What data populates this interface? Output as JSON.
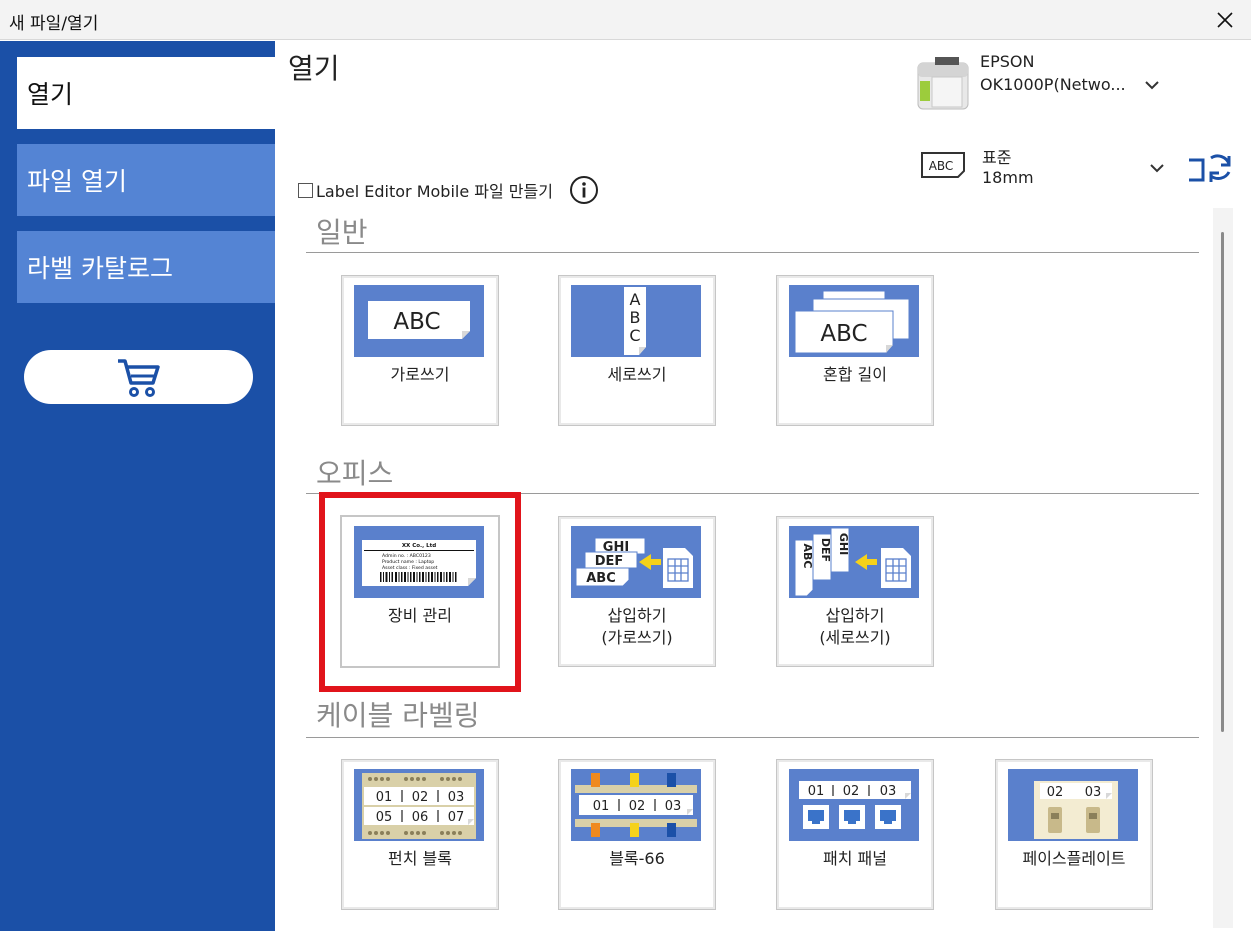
{
  "window": {
    "title": "새 파일/열기",
    "close_icon": "close-icon"
  },
  "sidebar": {
    "items": [
      {
        "label": "열기",
        "active": true
      },
      {
        "label": "파일 열기",
        "active": false
      },
      {
        "label": "라벨 카탈로그",
        "active": false
      }
    ],
    "cart_icon": "cart-icon"
  },
  "main": {
    "title": "열기",
    "printer": {
      "brand": "EPSON",
      "model": "OK1000P(Netwo..."
    },
    "tape": {
      "type": "표준",
      "width": "18mm",
      "icon_text": "ABC"
    },
    "label_editor_mobile": {
      "label": "Label Editor Mobile 파일 만들기",
      "checked": false
    }
  },
  "sections": [
    {
      "title": "일반",
      "tiles": [
        {
          "label": "가로쓰기",
          "thumb_text": "ABC"
        },
        {
          "label": "세로쓰기",
          "thumb_text": [
            "A",
            "B",
            "C"
          ]
        },
        {
          "label": "혼합 길이",
          "thumb_text": "ABC"
        }
      ]
    },
    {
      "title": "오피스",
      "tiles": [
        {
          "label": "장비 관리",
          "selected": true,
          "thumb_text": {
            "company": "XX Co., Ltd",
            "rows": [
              "Admin no.      : ABC0123",
              "Product name : Laptop",
              "Asset class    : Fixed asset"
            ]
          }
        },
        {
          "label": "삽입하기\n(가로쓰기)",
          "thumb_text": [
            "GHI",
            "DEF",
            "ABC"
          ]
        },
        {
          "label": "삽입하기\n(세로쓰기)",
          "thumb_text": [
            "ABC",
            "DEF",
            "GHI"
          ]
        }
      ]
    },
    {
      "title": "케이블 라벨링",
      "tiles": [
        {
          "label": "펀치 블록",
          "thumb_text": [
            "01",
            "02",
            "03",
            "05",
            "06",
            "07"
          ]
        },
        {
          "label": "블록-66",
          "thumb_text": [
            "01",
            "02",
            "03"
          ]
        },
        {
          "label": "패치 패널",
          "thumb_text": [
            "01",
            "02",
            "03"
          ]
        },
        {
          "label": "페이스플레이트",
          "thumb_text": [
            "02",
            "03"
          ]
        }
      ]
    }
  ],
  "colors": {
    "sidebar": "#1b50a7",
    "nav_item": "#5484d4",
    "thumb": "#5a80cc",
    "highlight": "#e1141b"
  }
}
